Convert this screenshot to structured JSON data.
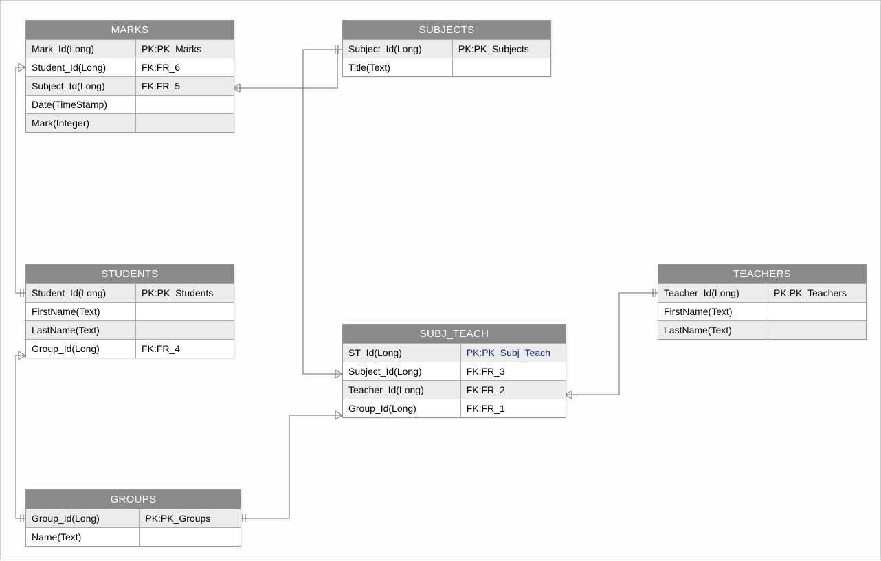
{
  "entities": {
    "marks": {
      "title": "MARKS",
      "rows": [
        {
          "name": "Mark_Id(Long)",
          "key": "PK:PK_Marks",
          "shade": true
        },
        {
          "name": "Student_Id(Long)",
          "key": "FK:FR_6",
          "shade": false
        },
        {
          "name": "Subject_Id(Long)",
          "key": "FK:FR_5",
          "shade": true
        },
        {
          "name": "Date(TimeStamp)",
          "key": "",
          "shade": false
        },
        {
          "name": "Mark(Integer)",
          "key": "",
          "shade": true
        }
      ]
    },
    "subjects": {
      "title": "SUBJECTS",
      "rows": [
        {
          "name": "Subject_Id(Long)",
          "key": "PK:PK_Subjects",
          "shade": true
        },
        {
          "name": "Title(Text)",
          "key": "",
          "shade": false
        }
      ]
    },
    "students": {
      "title": "STUDENTS",
      "rows": [
        {
          "name": "Student_Id(Long)",
          "key": "PK:PK_Students",
          "shade": true
        },
        {
          "name": "FirstName(Text)",
          "key": "",
          "shade": false
        },
        {
          "name": "LastName(Text)",
          "key": "",
          "shade": true
        },
        {
          "name": "Group_Id(Long)",
          "key": "FK:FR_4",
          "shade": false
        }
      ]
    },
    "subj_teach": {
      "title": "SUBJ_TEACH",
      "rows": [
        {
          "name": "ST_Id(Long)",
          "key": "PK:PK_Subj_Teach",
          "shade": true,
          "pkblue": true
        },
        {
          "name": "Subject_Id(Long)",
          "key": "FK:FR_3",
          "shade": false
        },
        {
          "name": "Teacher_Id(Long)",
          "key": "FK:FR_2",
          "shade": true
        },
        {
          "name": "Group_Id(Long)",
          "key": "FK:FR_1",
          "shade": false
        }
      ]
    },
    "teachers": {
      "title": "TEACHERS",
      "rows": [
        {
          "name": "Teacher_Id(Long)",
          "key": "PK:PK_Teachers",
          "shade": true
        },
        {
          "name": "FirstName(Text)",
          "key": "",
          "shade": false
        },
        {
          "name": "LastName(Text)",
          "key": "",
          "shade": true
        }
      ]
    },
    "groups": {
      "title": "GROUPS",
      "rows": [
        {
          "name": "Group_Id(Long)",
          "key": "PK:PK_Groups",
          "shade": true
        },
        {
          "name": "Name(Text)",
          "key": "",
          "shade": false
        }
      ]
    }
  },
  "relationships": [
    {
      "from": "marks.Subject_Id",
      "to": "subjects.Subject_Id",
      "fk": "FR_5"
    },
    {
      "from": "marks.Student_Id",
      "to": "students.Student_Id",
      "fk": "FR_6"
    },
    {
      "from": "students.Group_Id",
      "to": "groups.Group_Id",
      "fk": "FR_4"
    },
    {
      "from": "subj_teach.Subject_Id",
      "to": "subjects.Subject_Id",
      "fk": "FR_3"
    },
    {
      "from": "subj_teach.Teacher_Id",
      "to": "teachers.Teacher_Id",
      "fk": "FR_2"
    },
    {
      "from": "subj_teach.Group_Id",
      "to": "groups.Group_Id",
      "fk": "FR_1"
    }
  ]
}
